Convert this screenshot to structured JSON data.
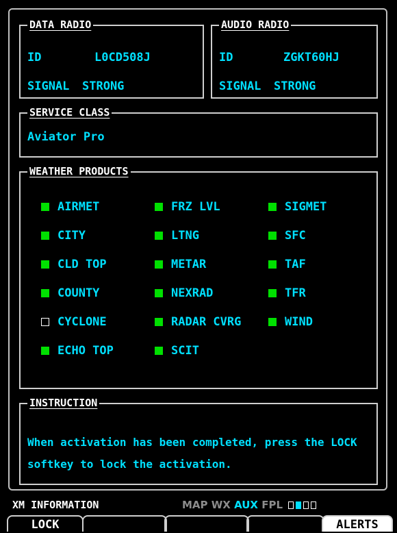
{
  "data_radio": {
    "title": "DATA RADIO",
    "id_label": "ID",
    "id_value": "L0CD508J",
    "signal_label": "SIGNAL",
    "signal_value": "STRONG"
  },
  "audio_radio": {
    "title": "AUDIO RADIO",
    "id_label": "ID",
    "id_value": "ZGKT60HJ",
    "signal_label": "SIGNAL",
    "signal_value": "STRONG"
  },
  "service_class": {
    "title": "SERVICE CLASS",
    "value": "Aviator Pro"
  },
  "weather_products": {
    "title": "WEATHER PRODUCTS",
    "items": [
      {
        "label": "AIRMET",
        "enabled": true
      },
      {
        "label": "FRZ LVL",
        "enabled": true
      },
      {
        "label": "SIGMET",
        "enabled": true
      },
      {
        "label": "CITY",
        "enabled": true
      },
      {
        "label": "LTNG",
        "enabled": true
      },
      {
        "label": "SFC",
        "enabled": true
      },
      {
        "label": "CLD TOP",
        "enabled": true
      },
      {
        "label": "METAR",
        "enabled": true
      },
      {
        "label": "TAF",
        "enabled": true
      },
      {
        "label": "COUNTY",
        "enabled": true
      },
      {
        "label": "NEXRAD",
        "enabled": true
      },
      {
        "label": "TFR",
        "enabled": true
      },
      {
        "label": "CYCLONE",
        "enabled": false
      },
      {
        "label": "RADAR CVRG",
        "enabled": true
      },
      {
        "label": "WIND",
        "enabled": true
      },
      {
        "label": "ECHO TOP",
        "enabled": true
      },
      {
        "label": "SCIT",
        "enabled": true
      }
    ]
  },
  "instruction": {
    "title": "INSTRUCTION",
    "text": "When activation has been completed, press the LOCK softkey to lock the activation."
  },
  "status_bar": {
    "page_name": "XM INFORMATION",
    "page_groups": [
      {
        "label": "MAP",
        "active": false
      },
      {
        "label": "WX",
        "active": false
      },
      {
        "label": "AUX",
        "active": true
      },
      {
        "label": "FPL",
        "active": false
      }
    ],
    "page_indicators": [
      false,
      true,
      false,
      false
    ]
  },
  "softkeys": [
    "LOCK",
    "",
    "",
    "",
    "ALERTS"
  ],
  "colors": {
    "accent": "#00e0ff",
    "on": "#00e000",
    "inactive_group": "#8c8c8c"
  }
}
